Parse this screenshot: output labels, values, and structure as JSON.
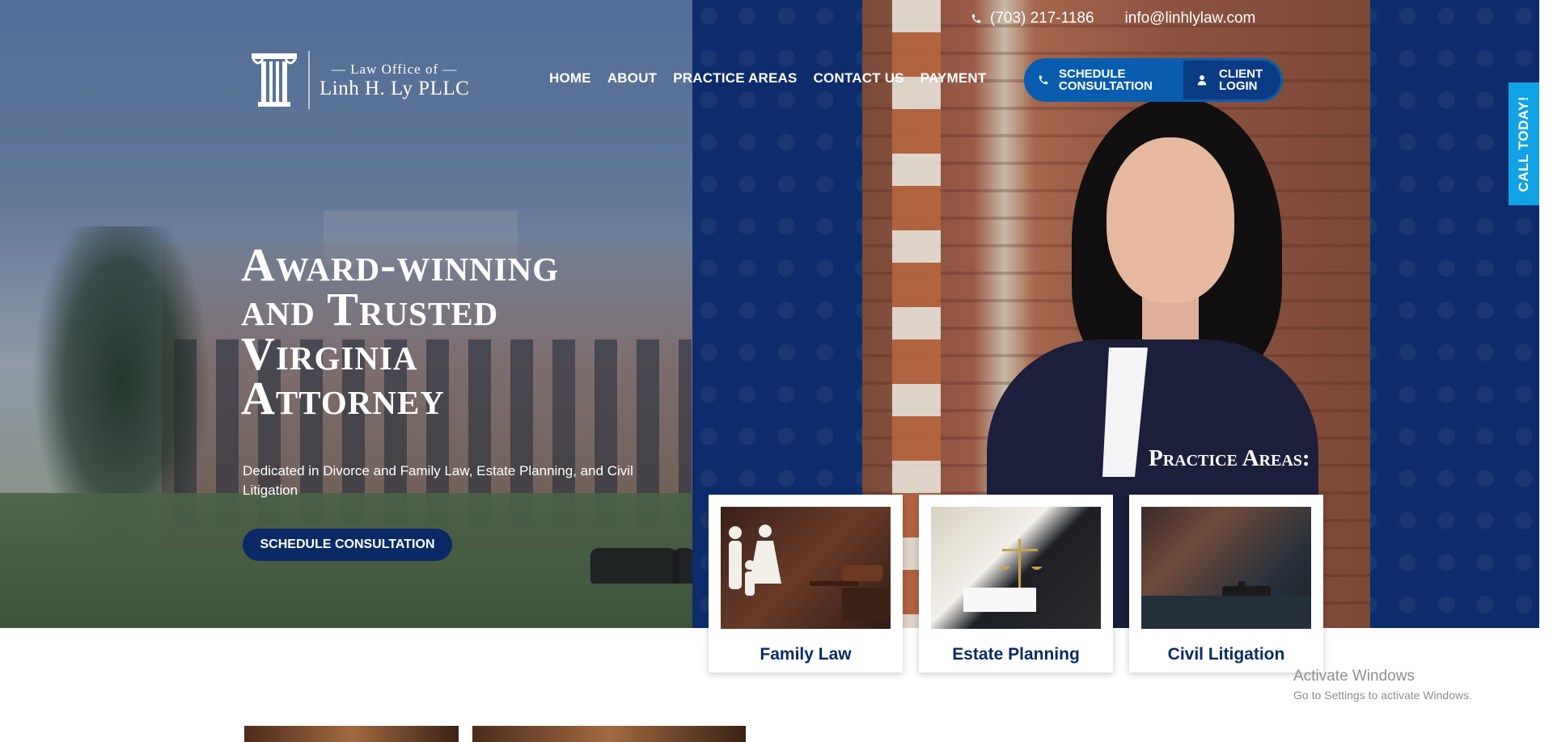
{
  "topbar": {
    "phone": "(703) 217-1186",
    "email": "info@linhlylaw.com"
  },
  "logo": {
    "line1": "— Law Office of —",
    "line2": "Linh H. Ly PLLC"
  },
  "nav": {
    "items": [
      "HOME",
      "ABOUT",
      "PRACTICE AREAS",
      "CONTACT US",
      "PAYMENT"
    ]
  },
  "cta": {
    "schedule_line1": "SCHEDULE",
    "schedule_line2": "CONSULTATION",
    "login_line1": "CLIENT",
    "login_line2": "LOGIN"
  },
  "side_tab": {
    "label": "CALL TODAY!"
  },
  "hero": {
    "title_lines": [
      "Award-winning",
      "and Trusted",
      "Virginia",
      "Attorney"
    ],
    "subtitle": "Dedicated in Divorce and Family Law, Estate Planning, and Civil Litigation",
    "button": "SCHEDULE CONSULTATION"
  },
  "practice_areas": {
    "heading": "Practice Areas:",
    "cards": [
      {
        "label": "Family Law"
      },
      {
        "label": "Estate Planning"
      },
      {
        "label": "Civil Litigation"
      }
    ]
  },
  "watermark": {
    "line1": "Activate Windows",
    "line2": "Go to Settings to activate Windows."
  },
  "colors": {
    "navy": "#0d2c6b",
    "cta_blue": "#0a5dae",
    "call_tab": "#11a3e6",
    "card_text": "#0a2b60"
  }
}
